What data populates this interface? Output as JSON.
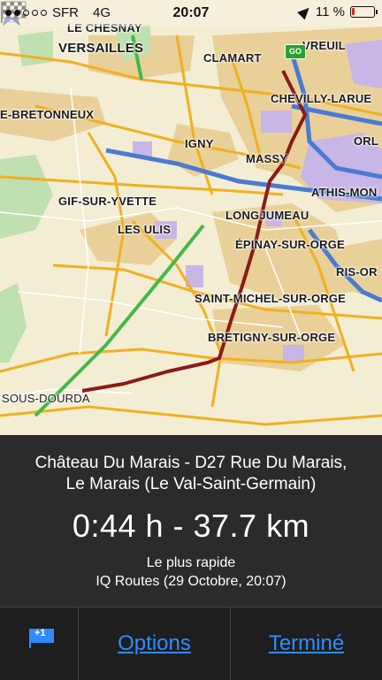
{
  "status_bar": {
    "carrier": "SFR",
    "network": "4G",
    "time": "20:07",
    "battery_text": "11 %",
    "battery_level": 0.11,
    "signal_bars": 2,
    "colors": {
      "battery_low": "#e02020"
    }
  },
  "map": {
    "towns": {
      "le_chesnay": "LE CHESNAY",
      "versailles": "VERSAILLES",
      "clamart": "CLAMART",
      "vreuil": "VREUIL",
      "chevilly": "CHEVILLY-LARUE",
      "bretonneux": "E-BRETONNEUX",
      "igny": "IGNY",
      "massy": "MASSY",
      "orly": "ORL",
      "athis": "ATHIS-MON",
      "gif": "GIF-SUR-YVETTE",
      "longjumeau": "LONGJUMEAU",
      "les_ulis": "LES ULIS",
      "epinay": "ÉPINAY-SUR-ORGE",
      "ris": "RIS-OR",
      "saint_michel": "SAINT-MICHEL-SUR-ORGE",
      "bretigny": "BRETIGNY-SUR-ORGE",
      "sous_dourdan": "SOUS-DOURDA"
    },
    "go_sign": "GO",
    "icons": {
      "position": "navigation-arrow-icon",
      "destination": "checkered-flag-icon"
    },
    "colors": {
      "route": "#8b1a1a",
      "land": "#f3edd4",
      "urban": "#e8cf95",
      "industrial": "#c8b6e6",
      "forest": "#bfe0b0",
      "highway": "#4a7bd0",
      "main_road": "#f0b020"
    }
  },
  "route_info": {
    "destination_line1": "Château Du Marais - D27 Rue Du Marais,",
    "destination_line2": "Le Marais (Le Val-Saint-Germain)",
    "summary": "0:44 h - 37.7 km",
    "route_type": "Le plus rapide",
    "route_source": "IQ Routes (29 Octobre, 20:07)"
  },
  "toolbar": {
    "flag_icon": "flag-plus-icon",
    "flag_count": "+1",
    "options_label": "Options",
    "done_label": "Terminé",
    "colors": {
      "link": "#2f8cff"
    }
  }
}
